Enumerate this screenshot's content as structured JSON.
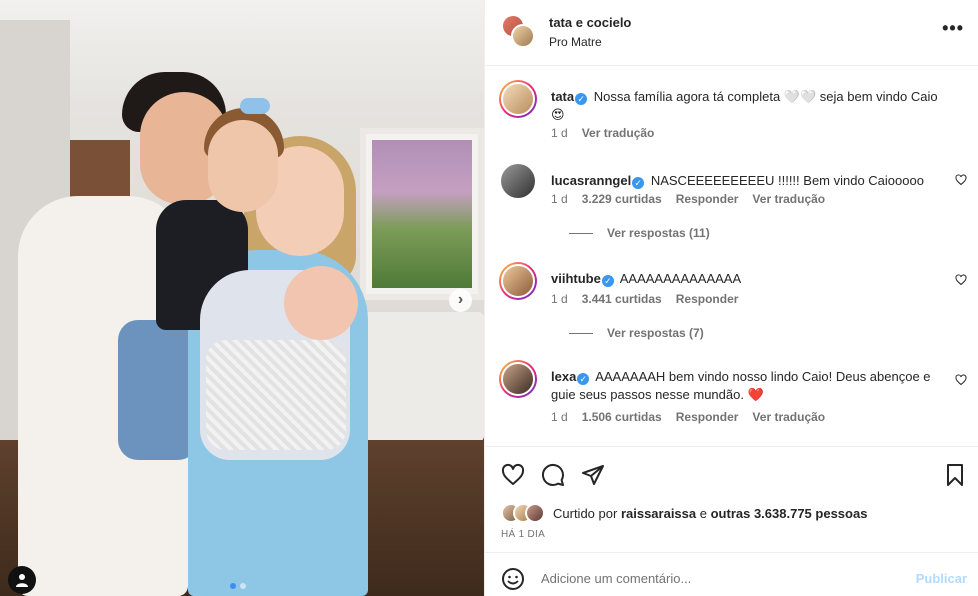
{
  "post": {
    "owner": "tata e cocielo",
    "location": "Pro Matre",
    "more_label": "•••"
  },
  "carousel": {
    "next_label": "›",
    "current_index": 1,
    "total": 2
  },
  "comments": [
    {
      "username": "tata",
      "verified": true,
      "text": "Nossa família agora tá completa 🤍🤍 seja bem vindo Caio 😍",
      "time": "1 d",
      "likes": "",
      "reply": "",
      "translate": "Ver tradução"
    },
    {
      "username": "lucasranngel",
      "verified": true,
      "text": "NASCEEEEEEEEEU !!!!!! Bem vindo Caiooooo",
      "time": "1 d",
      "likes": "3.229 curtidas",
      "reply": "Responder",
      "translate": "Ver tradução",
      "view_replies": "Ver respostas (11)"
    },
    {
      "username": "viihtube",
      "verified": true,
      "text": "AAAAAAAAAAAAAA",
      "time": "1 d",
      "likes": "3.441 curtidas",
      "reply": "Responder",
      "view_replies": "Ver respostas (7)"
    },
    {
      "username": "lexa",
      "verified": true,
      "text": "AAAAAAAH bem vindo nosso lindo Caio! Deus abençoe e guie seus passos nesse mundão. ❤️",
      "time": "1 d",
      "likes": "1.506 curtidas",
      "reply": "Responder",
      "translate": "Ver tradução"
    }
  ],
  "likes": {
    "prefix": "Curtido por",
    "user": "raissaraissa",
    "middle": "e",
    "others": "outras 3.638.775 pessoas"
  },
  "posted_ago": "HÁ 1 DIA",
  "add_comment": {
    "placeholder": "Adicione um comentário...",
    "publish_label": "Publicar"
  },
  "colors": {
    "accent_blue": "#0095f6",
    "publish_disabled": "#b3dbff",
    "verified": "#3897f0",
    "heart_red": "#ed4956",
    "muted": "#737373"
  }
}
